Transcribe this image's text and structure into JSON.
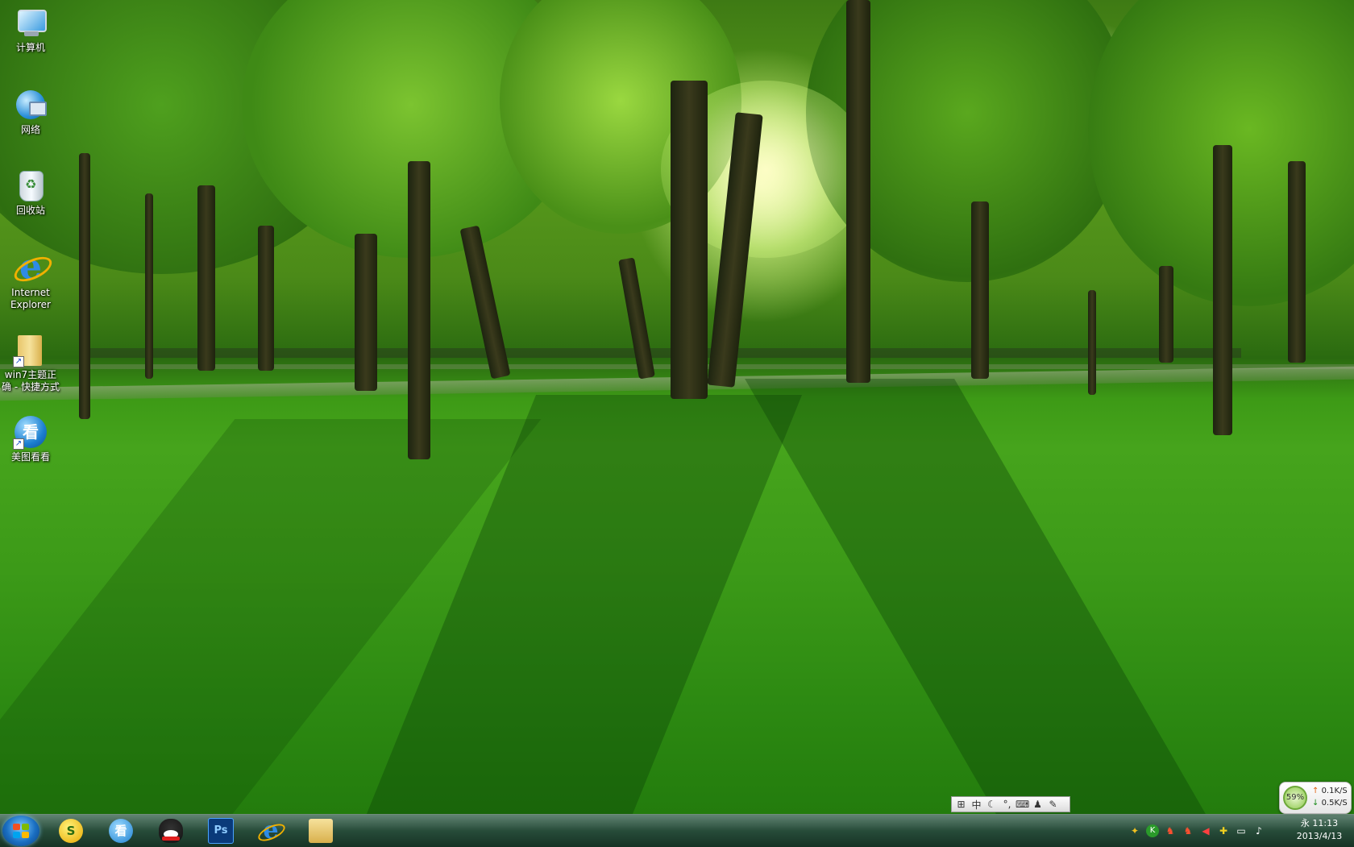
{
  "desktop": {
    "icons": [
      {
        "label": "计算机",
        "icon": "computer-icon"
      },
      {
        "label": "网络",
        "icon": "network-icon"
      },
      {
        "label": "回收站",
        "icon": "recycle-bin-icon"
      },
      {
        "label": "Internet Explorer",
        "icon": "internet-explorer-icon"
      },
      {
        "label": "win7主题正确 - 快捷方式",
        "icon": "folder-shortcut-icon"
      },
      {
        "label": "美图看看",
        "icon": "meitu-kankan-icon"
      }
    ]
  },
  "ime_bar": {
    "items": [
      "⊞",
      "中",
      "☾",
      "°,",
      "⌨",
      "♟",
      "✎"
    ],
    "mode_label": "中"
  },
  "net_widget": {
    "cpu_percent": "59%",
    "upload": "0.1K/S",
    "download": "0.5K/S"
  },
  "taskbar": {
    "pinned": [
      {
        "name": "sogou-browser",
        "glyph": "S",
        "color": "#f0c020"
      },
      {
        "name": "meitu-kankan",
        "glyph": "看",
        "color": "#1c7fd0"
      },
      {
        "name": "qq",
        "glyph": "◉",
        "color": "#222222"
      },
      {
        "name": "photoshop",
        "glyph": "Ps",
        "color": "#0a3a7a"
      },
      {
        "name": "internet-explorer",
        "glyph": "e",
        "color": "#2e8be6"
      },
      {
        "name": "windows-explorer",
        "glyph": "▤",
        "color": "#d9b04c"
      }
    ],
    "tray_icons": [
      "✦",
      "K",
      "♞",
      "♞",
      "◀",
      "✚",
      "▭",
      "♪"
    ],
    "clock_time": "永 11:13",
    "clock_date": "2013/4/13"
  },
  "colors": {
    "start_flag": [
      "#f25022",
      "#7fba00",
      "#00a4ef",
      "#ffb900"
    ]
  }
}
